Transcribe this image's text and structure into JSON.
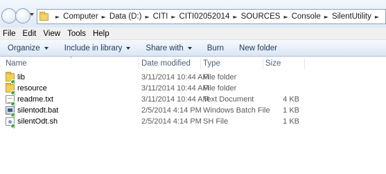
{
  "breadcrumb": [
    "Computer",
    "Data (D:)",
    "CITI",
    "CITI02052014",
    "SOURCES",
    "Console",
    "SilentUtility"
  ],
  "menu": [
    "File",
    "Edit",
    "View",
    "Tools",
    "Help"
  ],
  "toolbar": {
    "organize": "Organize",
    "include": "Include in library",
    "share": "Share with",
    "burn": "Burn",
    "new_folder": "New folder"
  },
  "columns": {
    "name": "Name",
    "date": "Date modified",
    "type": "Type",
    "size": "Size"
  },
  "files": [
    {
      "name": "lib",
      "date": "3/11/2014 10:44 AM",
      "type": "File folder",
      "size": "",
      "icon": "folder-icon"
    },
    {
      "name": "resource",
      "date": "3/11/2014 10:44 AM",
      "type": "File folder",
      "size": "",
      "icon": "folder-icon"
    },
    {
      "name": "readme.txt",
      "date": "3/11/2014 10:44 AM",
      "type": "Text Document",
      "size": "4 KB",
      "icon": "text-file-icon"
    },
    {
      "name": "silentodt.bat",
      "date": "2/5/2014 4:14 PM",
      "type": "Windows Batch File",
      "size": "1 KB",
      "icon": "batch-file-icon"
    },
    {
      "name": "silentOdt.sh",
      "date": "2/5/2014 4:14 PM",
      "type": "SH File",
      "size": "1 KB",
      "icon": "sh-file-icon"
    }
  ],
  "colors": {
    "toolbar_text": "#1e395b",
    "column_header_text": "#4c607a",
    "sync_badge": "#3fa33f"
  }
}
